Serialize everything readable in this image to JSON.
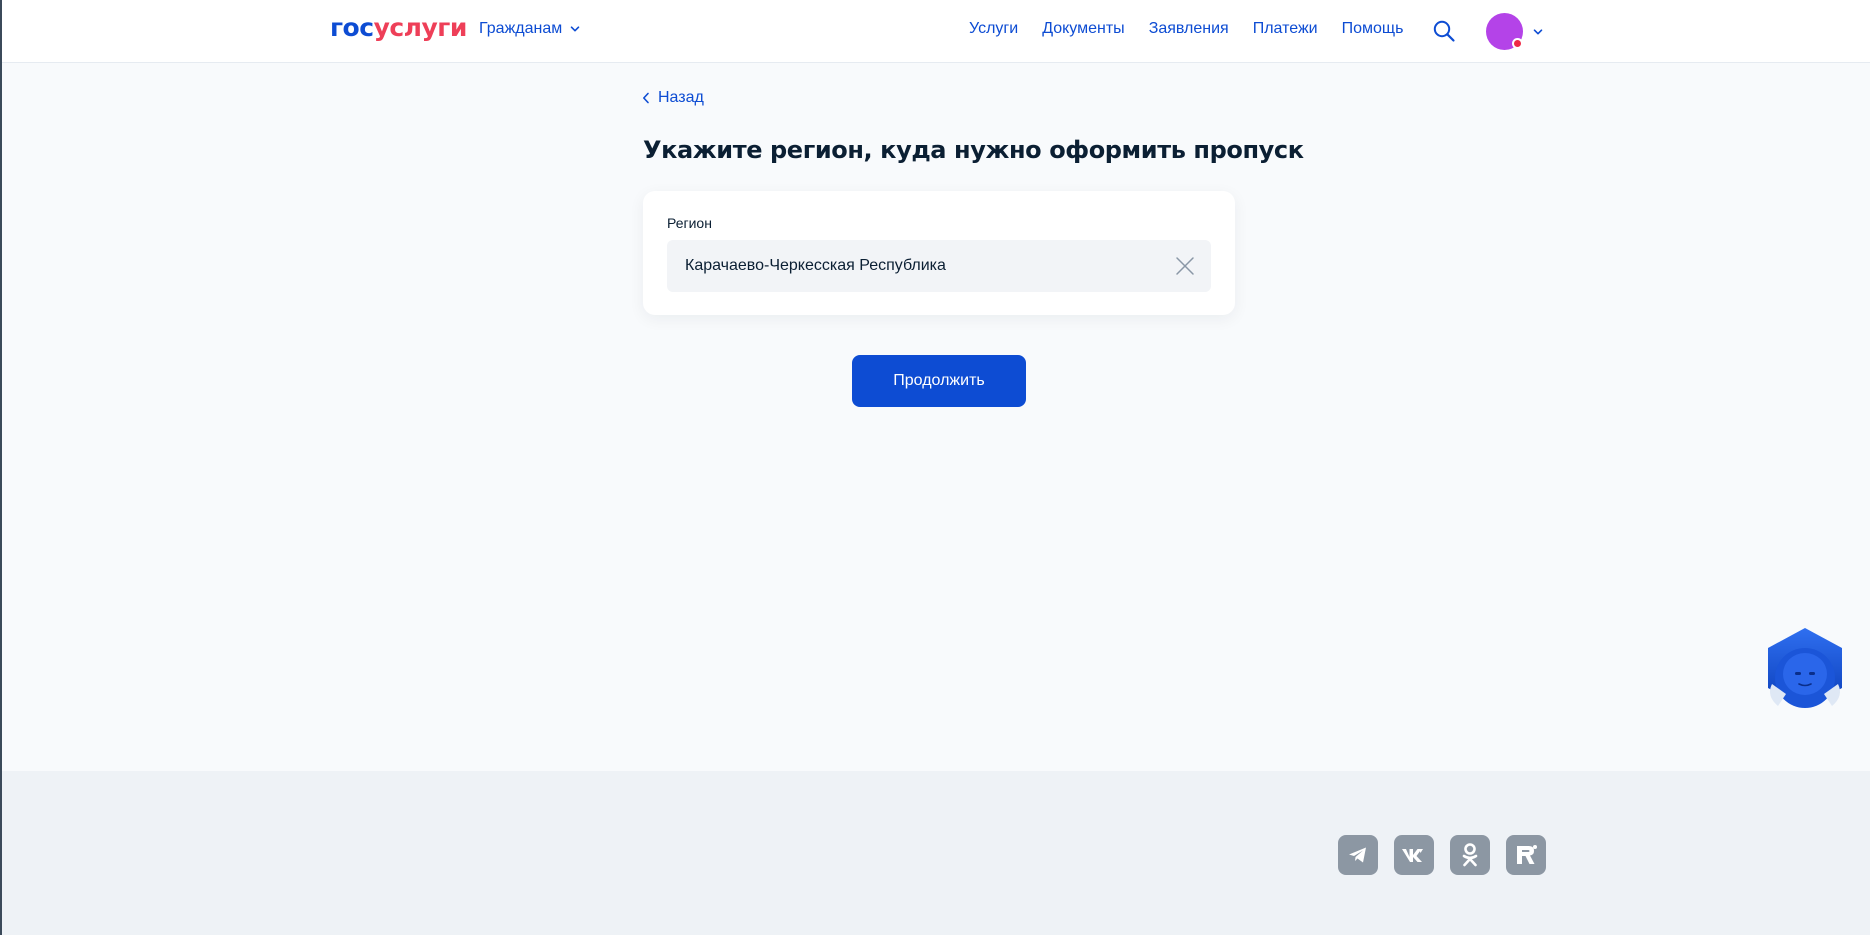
{
  "header": {
    "logo_part1": "гос",
    "logo_part2": "услуги",
    "audience_label": "Гражданам",
    "nav": [
      "Услуги",
      "Документы",
      "Заявления",
      "Платежи",
      "Помощь"
    ]
  },
  "main": {
    "back_label": "Назад",
    "title": "Укажите регион, куда нужно оформить пропуск",
    "region_label": "Регион",
    "region_value": "Карачаево-Черкесская Республика",
    "continue_label": "Продолжить"
  },
  "footer": {
    "socials": [
      "telegram-icon",
      "vk-icon",
      "odnoklassniki-icon",
      "rutube-icon"
    ]
  },
  "colors": {
    "brand_blue": "#0d4cd3",
    "brand_red": "#ee3f58",
    "page_bg": "#f8fafc",
    "footer_bg": "#eef2f6",
    "avatar": "#b443e8"
  }
}
